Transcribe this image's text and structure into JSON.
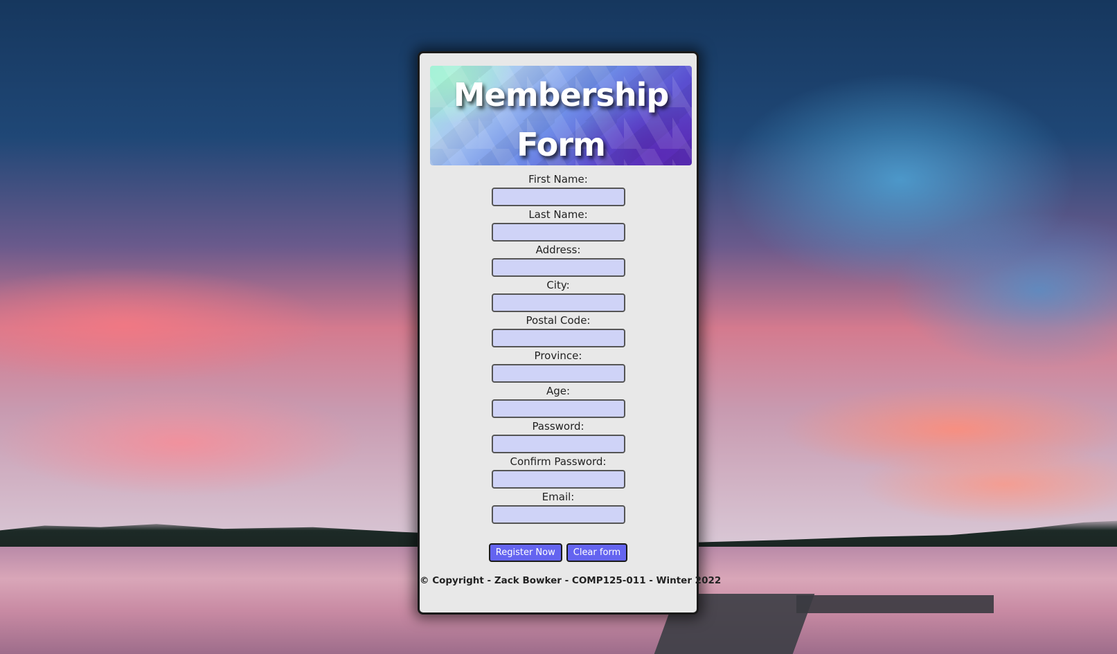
{
  "header": {
    "title_line1": "Membership",
    "title_line2": "Form"
  },
  "form": {
    "fields": [
      {
        "label": "First Name:",
        "value": ""
      },
      {
        "label": "Last Name:",
        "value": ""
      },
      {
        "label": "Address:",
        "value": ""
      },
      {
        "label": "City:",
        "value": ""
      },
      {
        "label": "Postal Code:",
        "value": ""
      },
      {
        "label": "Province:",
        "value": ""
      },
      {
        "label": "Age:",
        "value": ""
      },
      {
        "label": "Password:",
        "value": ""
      },
      {
        "label": "Confirm Password:",
        "value": ""
      },
      {
        "label": "Email:",
        "value": ""
      }
    ],
    "submit_label": "Register Now",
    "clear_label": "Clear form"
  },
  "footer": {
    "copyright": "©  Copyright - Zack Bowker - COMP125-011 - Winter 2022"
  },
  "colors": {
    "card_background": "#e8e8e8",
    "input_background": "#cfd3f7",
    "button_background": "#6464f0",
    "button_text": "#ffffff"
  }
}
